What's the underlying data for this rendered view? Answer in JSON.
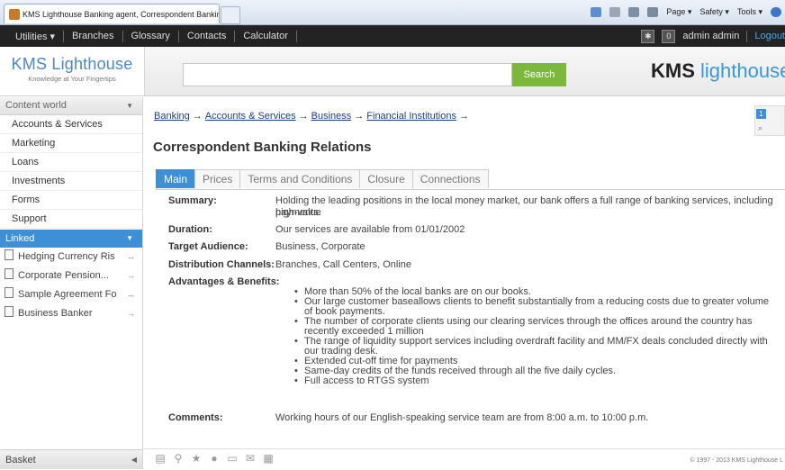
{
  "browser": {
    "tab_title": "KMS Lighthouse Banking agent, Correspondent Bankin...",
    "commands": [
      "Page ▾",
      "Safety ▾",
      "Tools ▾"
    ]
  },
  "topnav": {
    "utilities": "Utilities ▾",
    "items": [
      "Branches",
      "Glossary",
      "Contacts",
      "Calculator"
    ],
    "count": "0",
    "user": "admin admin",
    "logout": "Logout"
  },
  "header": {
    "logo_title": "KMS Lighthouse",
    "logo_tagline": "Knowledge at Your Fingertips",
    "search_value": "",
    "search_button": "Search",
    "brand_kms": "KMS",
    "brand_lighthouse": "lighthouse"
  },
  "sidebar": {
    "content_world": "Content world",
    "items": [
      "Accounts & Services",
      "Marketing",
      "Loans",
      "Investments",
      "Forms",
      "Support"
    ],
    "linked_label": "Linked",
    "linked_items": [
      {
        "label": "Hedging Currency Ris",
        "arrow": "↔"
      },
      {
        "label": "Corporate Pension...",
        "arrow": "→"
      },
      {
        "label": "Sample Agreement Fo",
        "arrow": "↔"
      },
      {
        "label": "Business Banker",
        "arrow": "→"
      }
    ],
    "basket": "Basket"
  },
  "main": {
    "breadcrumb": [
      "Banking",
      "Accounts & Services",
      "Business",
      "Financial Institutions"
    ],
    "tools_count": "1",
    "title": "Correspondent Banking Relations",
    "tabs": [
      "Main",
      "Prices",
      "Terms and Conditions",
      "Closure",
      "Connections"
    ],
    "summary_label": "Summary:",
    "summary_line1": "Holding the leading positions in the local money market, our bank offers a full range of banking services, including high-value",
    "summary_line2": "payments.",
    "duration_label": "Duration:",
    "duration": "Our services are available from 01/01/2002",
    "audience_label": "Target Audience:",
    "audience": "Business, Corporate",
    "channels_label": "Distribution Channels:",
    "channels": "Branches, Call Centers, Online",
    "advantages_label": "Advantages & Benefits:",
    "advantages": [
      "More than 50% of the local banks are on our books.",
      "Our large customer baseallows clients to benefit substantially from a reducing costs due to greater volume of book payments.",
      "The number of corporate clients using our clearing services through the offices around the country has recently exceeded 1 million",
      "The range of liquidity support services including overdraft facility and MM/FX deals concluded directly with our trading desk.",
      "Extended cut-off time for payments",
      "Same-day credits of the funds received through all the five daily cycles.",
      "Full access to RTGS system"
    ],
    "comments_label": "Comments:",
    "comments": "Working hours of our English-speaking service team are from 8:00 a.m. to 10:00 p.m."
  },
  "footer": {
    "copyright": "© 1997 - 2013 KMS Lighthouse L"
  }
}
